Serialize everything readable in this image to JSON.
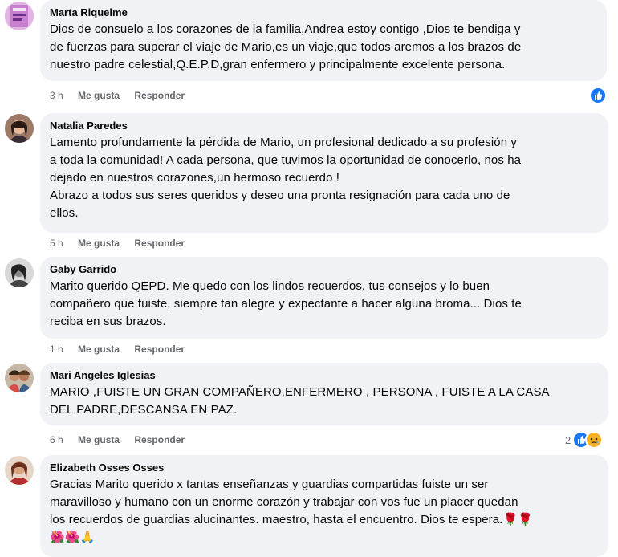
{
  "comments": [
    {
      "author": "Marta Riquelme",
      "text": "Dios de consuelo a los corazones de la familia,Andrea estoy contigo ,Dios te bendiga y\nde fuerzas para superar el viaje de Mario,es un viaje,que todos aremos a los brazos de\nnuestro padre celestial,Q.E.P.D,gran enfermero y principalmente excelente persona.",
      "time": "3 h",
      "like_label": "Me gusta",
      "reply_label": "Responder",
      "reactions": [
        "like-icon"
      ],
      "reaction_count": ""
    },
    {
      "author": "Natalia Paredes",
      "text": "Lamento profundamente la pérdida de Mario, un profesional dedicado a su profesión y\na toda la comunidad! A cada persona, que tuvimos la oportunidad de conocerlo, nos ha\ndejado en nuestros corazones,un hermoso recuerdo !\nAbrazo a todos sus seres queridos y deseo una pronta resignación para cada uno de\nellos.",
      "time": "5 h",
      "like_label": "Me gusta",
      "reply_label": "Responder"
    },
    {
      "author": "Gaby Garrido",
      "text": "Marito querido QEPD. Me quedo con los lindos recuerdos, tus consejos y lo buen\ncompañero que fuiste, siempre tan alegre y expectante a hacer alguna broma... Dios te\nreciba en sus brazos.",
      "time": "1 h",
      "like_label": "Me gusta",
      "reply_label": "Responder"
    },
    {
      "author": "Mari Angeles Iglesias",
      "text": "MARIO ,FUISTE UN GRAN COMPAÑERO,ENFERMERO , PERSONA , FUISTE A LA CASA\nDEL PADRE,DESCANSA EN PAZ.",
      "time": "6 h",
      "like_label": "Me gusta",
      "reply_label": "Responder",
      "reactions": [
        "like-icon",
        "sad-icon"
      ],
      "reaction_count": "2"
    },
    {
      "author": "Elizabeth Osses Osses",
      "text": "Gracias Marito querido x tantas enseñanzas y guardias compartidas fuiste un ser\nmaravilloso y humano con un enorme corazón y trabajar con vos fue un placer quedan\nlos recuerdos de guardias alucinantes. maestro, hasta el encuentro. Dios te espera.🌹🌹\n🌺🌺🙏"
    }
  ],
  "colors": {
    "bubble": "#f0f2f5",
    "meta": "#65676b",
    "like": "#1877f2",
    "sad": "#f7b125"
  }
}
